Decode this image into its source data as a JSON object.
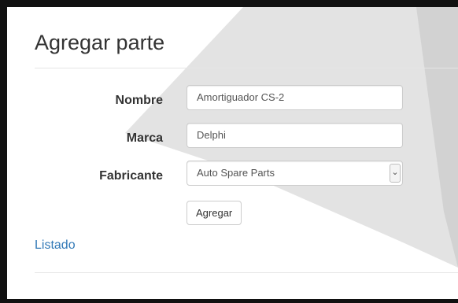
{
  "page": {
    "title": "Agregar parte"
  },
  "form": {
    "nombre": {
      "label": "Nombre",
      "value": "Amortiguador CS-2"
    },
    "marca": {
      "label": "Marca",
      "value": "Delphi"
    },
    "fabricante": {
      "label": "Fabricante",
      "value": "Auto Spare Parts"
    },
    "submit_label": "Agregar"
  },
  "nav": {
    "listado_label": "Listado"
  },
  "colors": {
    "link": "#337ab7",
    "background_shape": "#e4e4e4"
  }
}
